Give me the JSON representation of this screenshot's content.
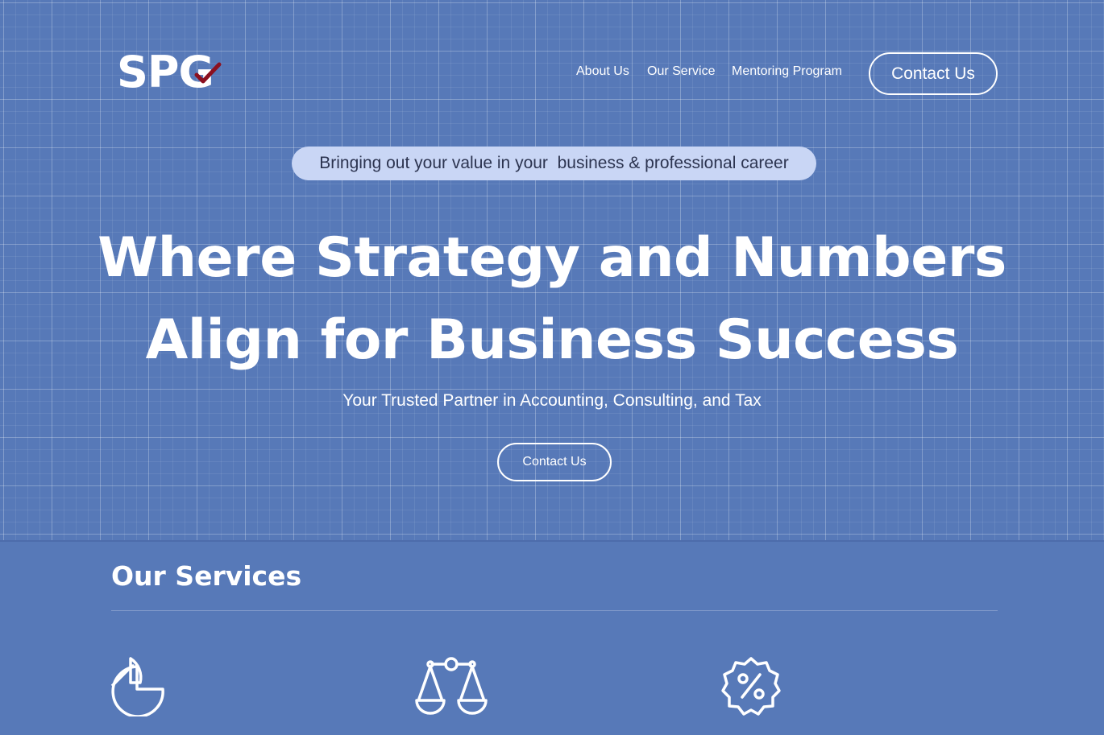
{
  "brand": {
    "logo_text": "SPG",
    "check_color": "#8b1020"
  },
  "nav": {
    "items": [
      {
        "label": "About Us"
      },
      {
        "label": "Our Service"
      },
      {
        "label": "Mentoring Program"
      }
    ],
    "contact_label": "Contact Us"
  },
  "hero": {
    "tagline": "Bringing out your value in your  business & professional career",
    "headline_line1": "Where Strategy and Numbers",
    "headline_line2": "Align for Business Success",
    "subheadline": "Your Trusted Partner in Accounting, Consulting, and Tax",
    "cta_label": "Contact Us"
  },
  "services": {
    "title": "Our Services",
    "icons": [
      "pie-chart-icon",
      "balance-scale-icon",
      "percent-badge-icon"
    ]
  },
  "colors": {
    "background": "#5779b8",
    "tagline_bg": "#c9d6f5",
    "tagline_text": "#2c3450",
    "text": "#ffffff"
  }
}
